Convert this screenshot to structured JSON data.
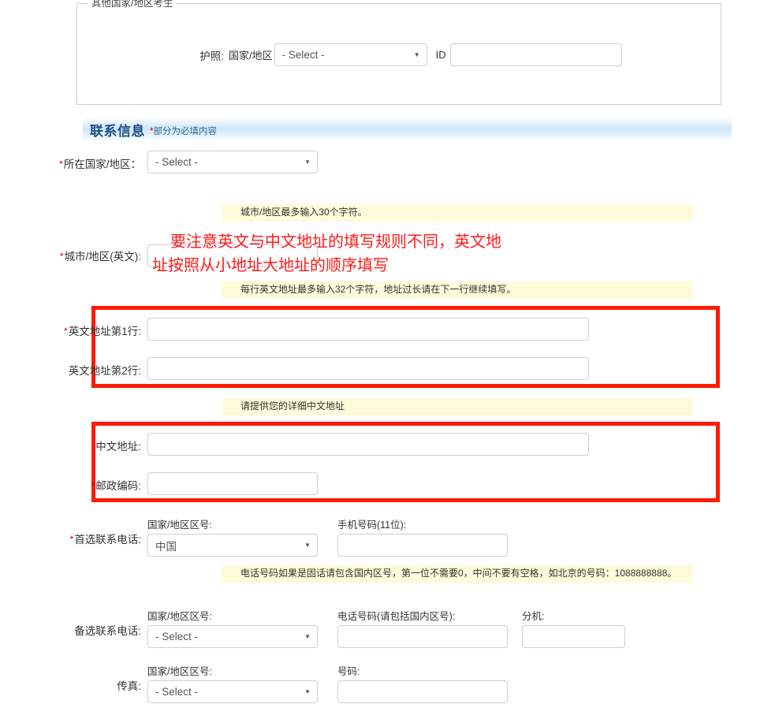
{
  "passport_section": {
    "legend": "其他国家/地区考生",
    "label": "护照:",
    "country_label": "国家/地区",
    "country_value": "- Select -",
    "id_label": "ID",
    "id_value": ""
  },
  "contact_section": {
    "title": "联系信息",
    "note_star": "*",
    "note_text": "部分为必填内容"
  },
  "fields": {
    "country": {
      "label": "所在国家/地区：",
      "required": true,
      "value": "- Select -"
    },
    "city_en": {
      "label": "城市/地区(英文):",
      "required": true,
      "value": ""
    },
    "addr_en_1": {
      "label": "英文地址第1行:",
      "required": true,
      "value": ""
    },
    "addr_en_2": {
      "label": "英文地址第2行:",
      "required": false,
      "value": ""
    },
    "addr_cn": {
      "label": "中文地址:",
      "required": false,
      "value": ""
    },
    "postcode": {
      "label": "邮政编码:",
      "required": true,
      "value": ""
    },
    "primary_phone": {
      "label": "首选联系电话:",
      "required": true,
      "country_code_caption": "国家/地区区号:",
      "country_code_value": "中国",
      "number_caption": "手机号码(11位):",
      "number_value": ""
    },
    "alt_phone": {
      "label": "备选联系电话:",
      "required": false,
      "country_code_caption": "国家/地区区号:",
      "country_code_value": "- Select -",
      "number_caption": "电话号码(请包括国内区号):",
      "number_value": "",
      "ext_caption": "分机:",
      "ext_value": ""
    },
    "fax": {
      "label": "传真:",
      "required": false,
      "country_code_caption": "国家/地区区号:",
      "country_code_value": "- Select -",
      "number_caption": "号码:",
      "number_value": ""
    }
  },
  "hints": {
    "city": "城市/地区最多输入30个字符。",
    "address_en": "每行英文地址最多输入32个字符，地址过长请在下一行继续填写。",
    "address_cn": "请提供您的详细中文地址",
    "phone": "电话号码如果是固话请包含国内区号，第一位不需要0，中间不要有空格，如北京的号码：1088888888。"
  },
  "annotations": {
    "red_note_line1": "要注意英文与中文地址的填写规则不同，英文地",
    "red_note_line2": "址按照从小地址大地址的顺序填写",
    "red_color": "#ff1a00"
  },
  "icons": {
    "dropdown_caret": "▼"
  }
}
